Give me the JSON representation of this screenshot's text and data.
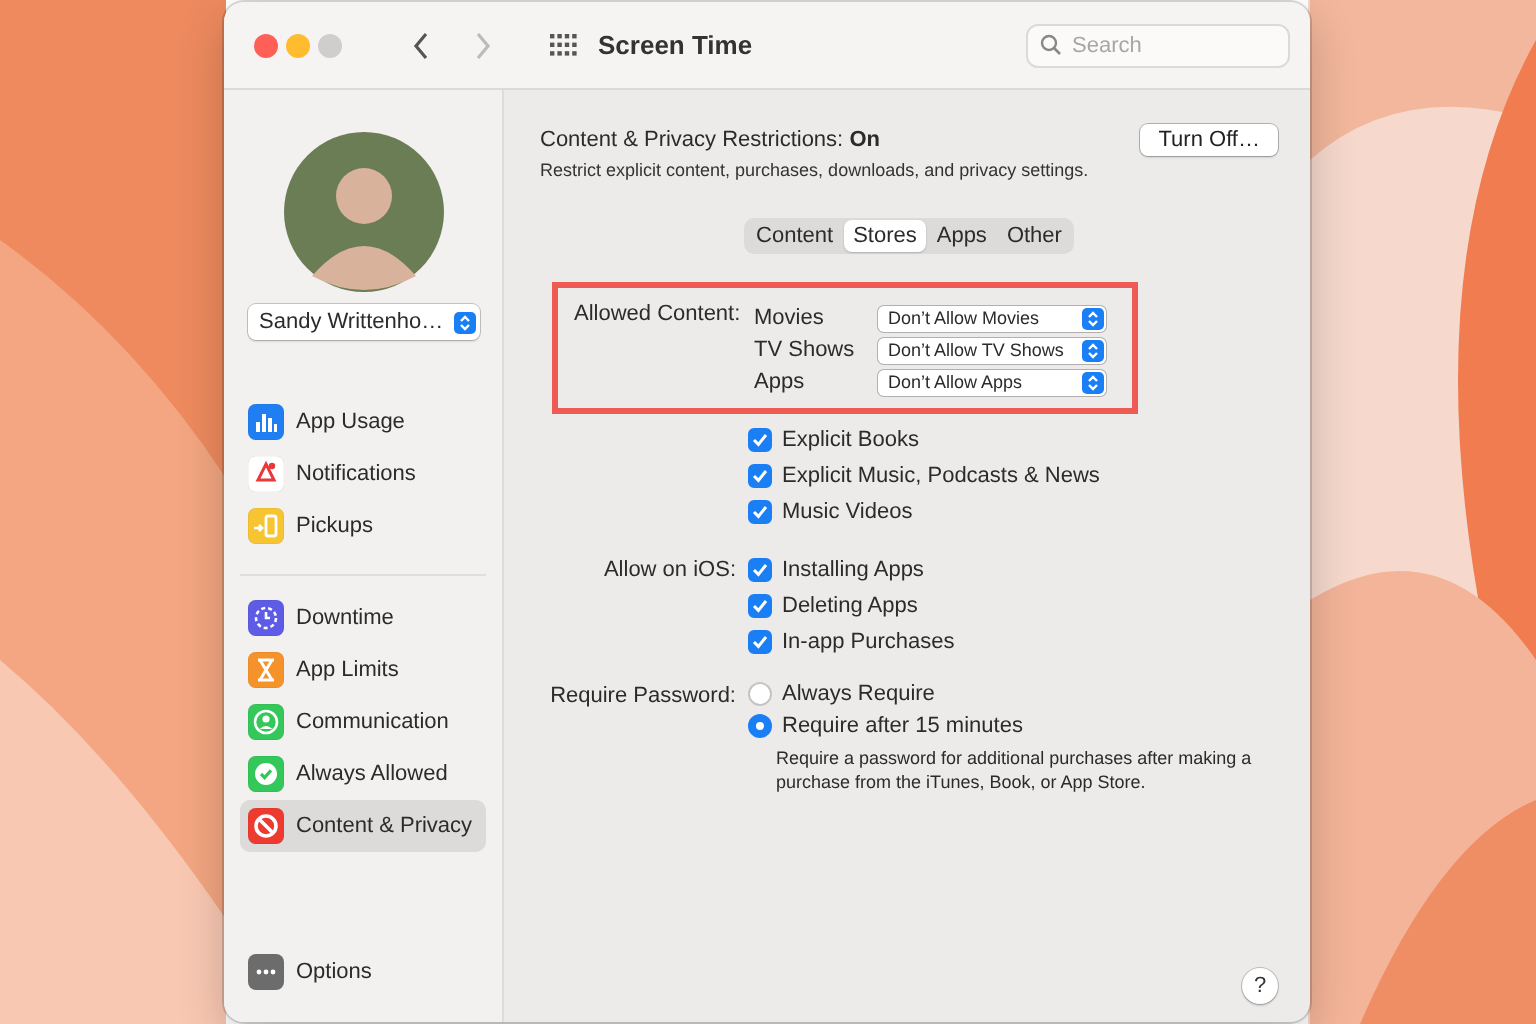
{
  "window": {
    "title": "Screen Time",
    "controls": [
      {
        "kind": "close",
        "disabled": false
      },
      {
        "kind": "minimize",
        "disabled": false
      },
      {
        "kind": "zoom",
        "disabled": true
      }
    ],
    "nav": [
      {
        "kind": "back",
        "disabled": false
      },
      {
        "kind": "forward",
        "disabled": true
      }
    ],
    "search": {
      "placeholder": "Search"
    }
  },
  "sidebar": {
    "user": "Sandy Writtenho…",
    "groups": [
      {
        "items": [
          {
            "label": "App Usage",
            "selected": false
          },
          {
            "label": "Notifications",
            "selected": false
          },
          {
            "label": "Pickups",
            "selected": false
          }
        ]
      },
      {
        "items": [
          {
            "label": "Downtime",
            "selected": false
          },
          {
            "label": "App Limits",
            "selected": false
          },
          {
            "label": "Communication",
            "selected": false
          },
          {
            "label": "Always Allowed",
            "selected": false
          },
          {
            "label": "Content & Privacy",
            "selected": true
          }
        ]
      }
    ],
    "options": "Options"
  },
  "content": {
    "restrictions": {
      "label": "Content & Privacy Restrictions:",
      "status": "On",
      "description": "Restrict explicit content, purchases, downloads, and privacy settings.",
      "button": "Turn Off…"
    },
    "tabs": [
      {
        "label": "Content",
        "selected": false
      },
      {
        "label": "Stores",
        "selected": true
      },
      {
        "label": "Apps",
        "selected": false
      },
      {
        "label": "Other",
        "selected": false
      }
    ],
    "allowed_content": {
      "label": "Allowed Content:",
      "highlighted": true,
      "rows": [
        {
          "label": "Movies",
          "value": "Don’t Allow Movies"
        },
        {
          "label": "TV Shows",
          "value": "Don’t Allow TV Shows"
        },
        {
          "label": "Apps",
          "value": "Don’t Allow Apps"
        }
      ]
    },
    "explicit": [
      {
        "label": "Explicit Books",
        "checked": true
      },
      {
        "label": "Explicit Music, Podcasts & News",
        "checked": true
      },
      {
        "label": "Music Videos",
        "checked": true
      }
    ],
    "allow_on_ios": {
      "label": "Allow on iOS:",
      "items": [
        {
          "label": "Installing Apps",
          "checked": true
        },
        {
          "label": "Deleting Apps",
          "checked": true
        },
        {
          "label": "In-app Purchases",
          "checked": true
        }
      ]
    },
    "require_password": {
      "label": "Require Password:",
      "options": [
        {
          "label": "Always Require",
          "selected": false
        },
        {
          "label": "Require after 15 minutes",
          "selected": true
        }
      ],
      "note": "Require a password for additional purchases after making a purchase from the iTunes, Book, or App Store."
    },
    "help": "?"
  }
}
